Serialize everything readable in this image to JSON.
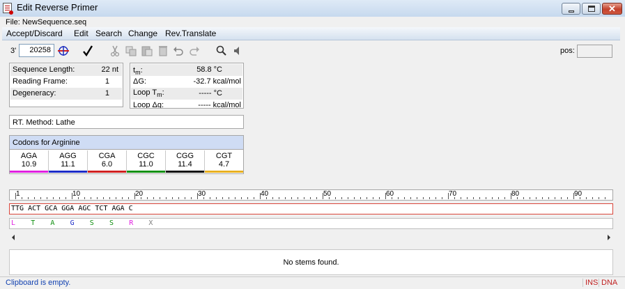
{
  "window": {
    "title": "Edit Reverse Primer",
    "close_glyph": "✕"
  },
  "file_line": "File: NewSequence.seq",
  "menu": [
    "Accept/Discard",
    "Edit",
    "Search",
    "Change",
    "Rev.Translate"
  ],
  "toolbar": {
    "end_label": "3'",
    "position_value": "20258",
    "pos_label": "pos:",
    "icons": [
      "primer-icon",
      "checkmark-icon",
      "cut-icon",
      "copy-icon",
      "paste-icon",
      "delete-icon",
      "undo-icon",
      "redo-icon",
      "search-icon",
      "speaker-icon"
    ]
  },
  "seq_info": [
    {
      "label": "Sequence Length:",
      "value": "22 nt"
    },
    {
      "label": "Reading Frame:",
      "value": "1"
    },
    {
      "label": "Degeneracy:",
      "value": "1"
    }
  ],
  "thermo": [
    {
      "label": "t",
      "sub": "m",
      "suffix": ":",
      "value": "58.8 °C"
    },
    {
      "label": "ΔG:",
      "sub": "",
      "suffix": "",
      "value": "-32.7 kcal/mol"
    },
    {
      "label": "Loop T",
      "sub": "m",
      "suffix": ":",
      "value": "----- °C"
    },
    {
      "label": "Loop Δg:",
      "sub": "",
      "suffix": "",
      "value": "----- kcal/mol"
    }
  ],
  "rt_method": "RT. Method: Lathe",
  "codons": {
    "title": "Codons for Arginine",
    "items": [
      {
        "codon": "AGA",
        "value": "10.9",
        "color": "#e020e0"
      },
      {
        "codon": "AGG",
        "value": "11.1",
        "color": "#1c2cc8"
      },
      {
        "codon": "CGA",
        "value": "6.0",
        "color": "#d02020"
      },
      {
        "codon": "CGC",
        "value": "11.0",
        "color": "#109010"
      },
      {
        "codon": "CGG",
        "value": "11.4",
        "color": "#101010"
      },
      {
        "codon": "CGT",
        "value": "4.7",
        "color": "#e8b020"
      }
    ]
  },
  "ruler": {
    "labels": [
      "1",
      "10",
      "20",
      "30",
      "40",
      "50",
      "60",
      "70",
      "80",
      "90"
    ]
  },
  "sequence": "TTG ACT GCA GGA AGC TCT AGA C",
  "amino_acids": [
    {
      "letter": "L",
      "color": "#e020e0"
    },
    {
      "letter": "T",
      "color": "#109010"
    },
    {
      "letter": "A",
      "color": "#109010"
    },
    {
      "letter": "G",
      "color": "#1c2cc8"
    },
    {
      "letter": "S",
      "color": "#109010"
    },
    {
      "letter": "S",
      "color": "#109010"
    },
    {
      "letter": "R",
      "color": "#e020e0"
    },
    {
      "letter": "X",
      "color": "#808080"
    }
  ],
  "stems_message": "No stems found.",
  "status": {
    "text": "Clipboard is empty.",
    "ins": "INS",
    "mode": "DNA"
  }
}
